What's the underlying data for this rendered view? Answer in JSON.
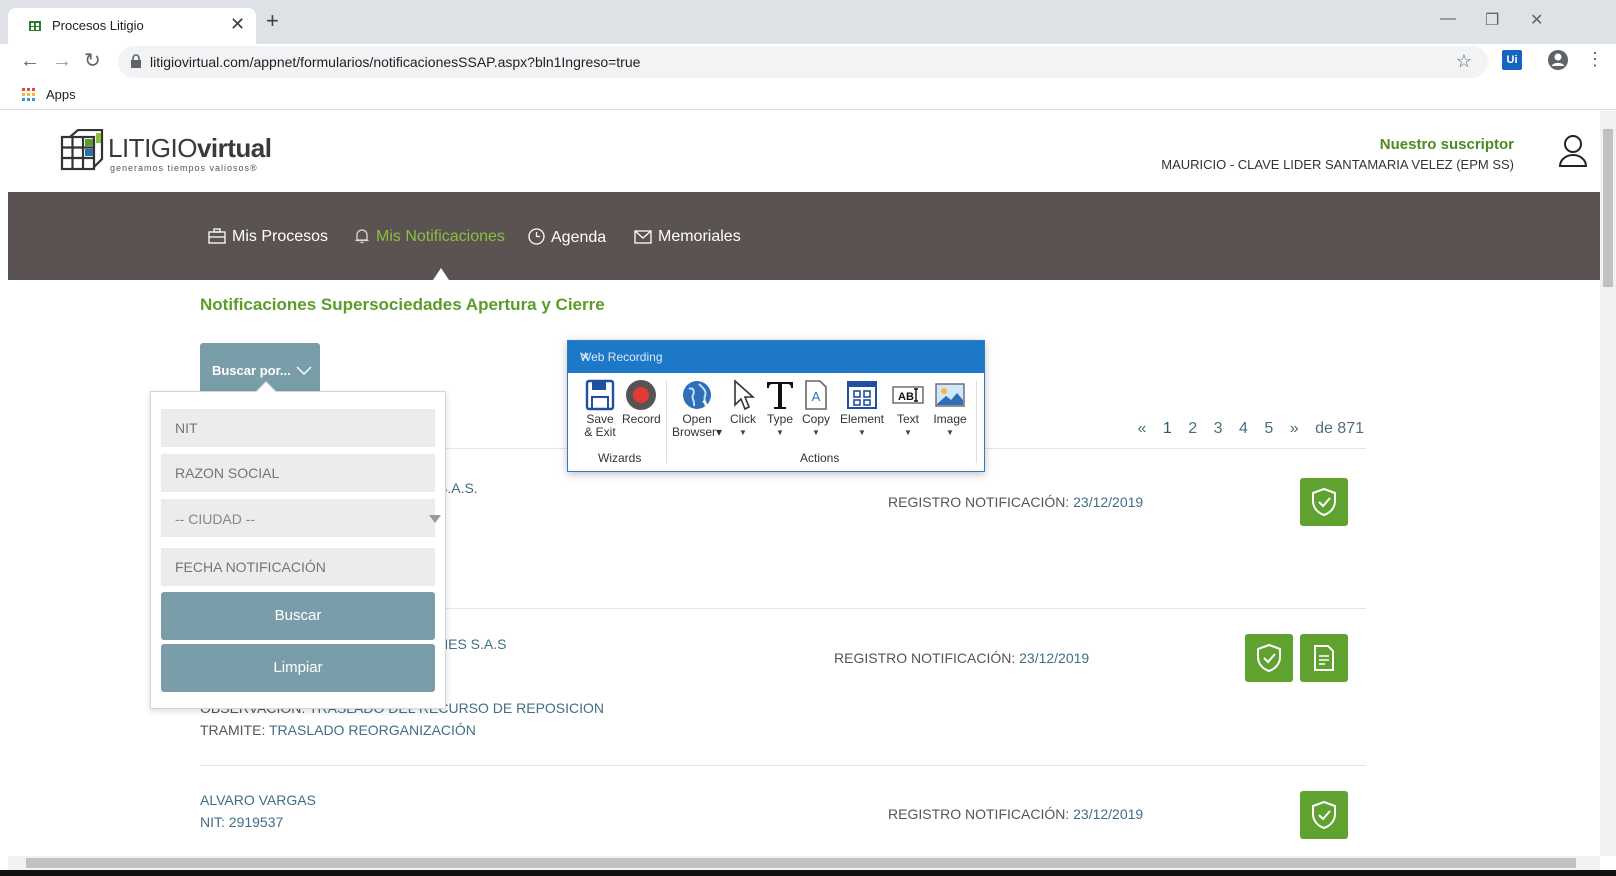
{
  "browser": {
    "tab_title": "Procesos Litigio",
    "tab_close": "✕",
    "new_tab": "+",
    "url": "litigiovirtual.com/appnet/formularios/notificacionesSSAP.aspx?bln1Ingreso=true",
    "bookmark_apps": "Apps",
    "ext_label": "Ui",
    "win_minimize": "—",
    "win_restore": "❐",
    "win_close": "✕",
    "back": "←",
    "forward": "→",
    "reload": "↻",
    "star": "☆",
    "kebab": "⋮"
  },
  "header": {
    "logo_text_light": "LITIGIO",
    "logo_text_bold": "virtual",
    "logo_tagline": "generamos tiempos valiosos®",
    "subscriber_label": "Nuestro suscriptor",
    "subscriber_name": "MAURICIO - CLAVE LIDER SANTAMARIA VELEZ (EPM SS)"
  },
  "nav": {
    "items": [
      {
        "label": "Mis Procesos",
        "icon": "briefcase-icon"
      },
      {
        "label": "Mis Notificaciones",
        "icon": "bell-icon",
        "active": true
      },
      {
        "label": "Agenda",
        "icon": "clock-icon"
      },
      {
        "label": "Memoriales",
        "icon": "envelope-icon"
      }
    ]
  },
  "page_title": "Notificaciones Supersociedades Apertura y Cierre",
  "search": {
    "toggle_label": "Buscar por...",
    "nit_placeholder": "NIT",
    "razon_placeholder": "RAZON SOCIAL",
    "ciudad_selected": "-- CIUDAD --",
    "fecha_placeholder": "FECHA NOTIFICACIÓN",
    "buscar_label": "Buscar",
    "limpiar_label": "Limpiar"
  },
  "pagination": {
    "prev": "«",
    "pages": [
      "1",
      "2",
      "3",
      "4",
      "5"
    ],
    "current": "1",
    "next": "»",
    "total": "de 871"
  },
  "records": [
    {
      "name_fragment": "S.A.S.",
      "registro_label": "REGISTRO NOTIFICACIÓN:",
      "registro_date": "23/12/2019"
    },
    {
      "name_fragment": "NES S.A.S",
      "registro_label": "REGISTRO NOTIFICACIÓN:",
      "registro_date": "23/12/2019",
      "observacion_label": "OBSERVACIÓN:",
      "observacion_value": "TRASLADO DEL RECURSO DE REPOSICION",
      "tramite_label": "TRAMITE:",
      "tramite_value": "TRASLADO REORGANIZACIÓN"
    },
    {
      "name": "ALVARO VARGAS",
      "nit": "NIT: 2919537",
      "registro_label": "REGISTRO NOTIFICACIÓN:",
      "registro_date": "23/12/2019"
    }
  ],
  "web_recording": {
    "title": "Web Recording",
    "close": "✕",
    "tools": {
      "save_exit": [
        "Save",
        "& Exit"
      ],
      "record": "Record",
      "open_browser": [
        "Open",
        "Browser"
      ],
      "click": "Click",
      "type": "Type",
      "copy": "Copy",
      "element": "Element",
      "text": "Text",
      "image": "Image"
    },
    "groups": {
      "wizards": "Wizards",
      "actions": "Actions"
    }
  },
  "colors": {
    "brand_green": "#5b9c2a",
    "nav_bg": "#5a5352",
    "active_nav": "#8cbf40",
    "button_slate": "#7a9ea9",
    "link_blue": "#3f6f86",
    "recorder_blue": "#1e78c8"
  }
}
